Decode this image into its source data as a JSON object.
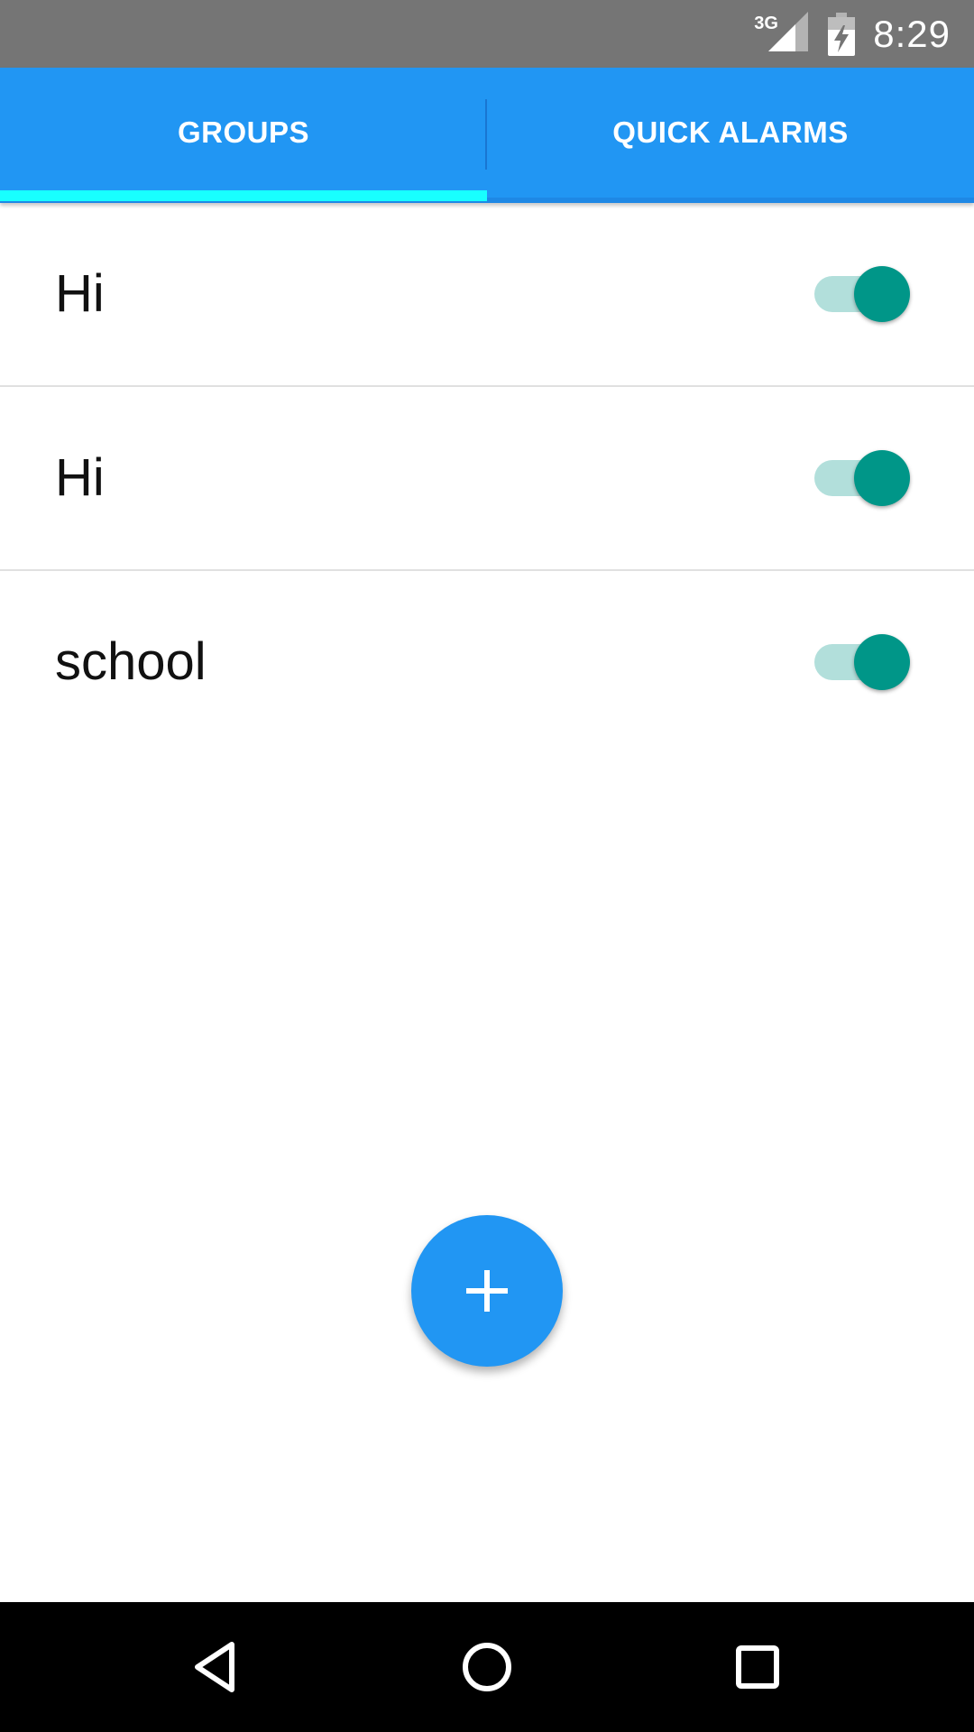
{
  "status_bar": {
    "network_type": "3G",
    "time": "8:29",
    "signal_icon": "cell-signal-icon",
    "battery_icon": "battery-charging-icon"
  },
  "tabs": [
    {
      "label": "GROUPS",
      "selected": true
    },
    {
      "label": "QUICK ALARMS",
      "selected": false
    }
  ],
  "groups": [
    {
      "name": "Hi",
      "enabled": true
    },
    {
      "name": "Hi",
      "enabled": true
    },
    {
      "name": "school",
      "enabled": true
    }
  ],
  "fab": {
    "icon": "plus-icon"
  },
  "nav_bar": {
    "icons": [
      "back-icon",
      "home-icon",
      "recents-icon"
    ]
  },
  "colors": {
    "status_bar": "#757575",
    "primary": "#2196F3",
    "tab_indicator": "#18FFFF",
    "switch_thumb": "#009688",
    "switch_track": "#B2DFDB",
    "nav_bar": "#000000"
  }
}
